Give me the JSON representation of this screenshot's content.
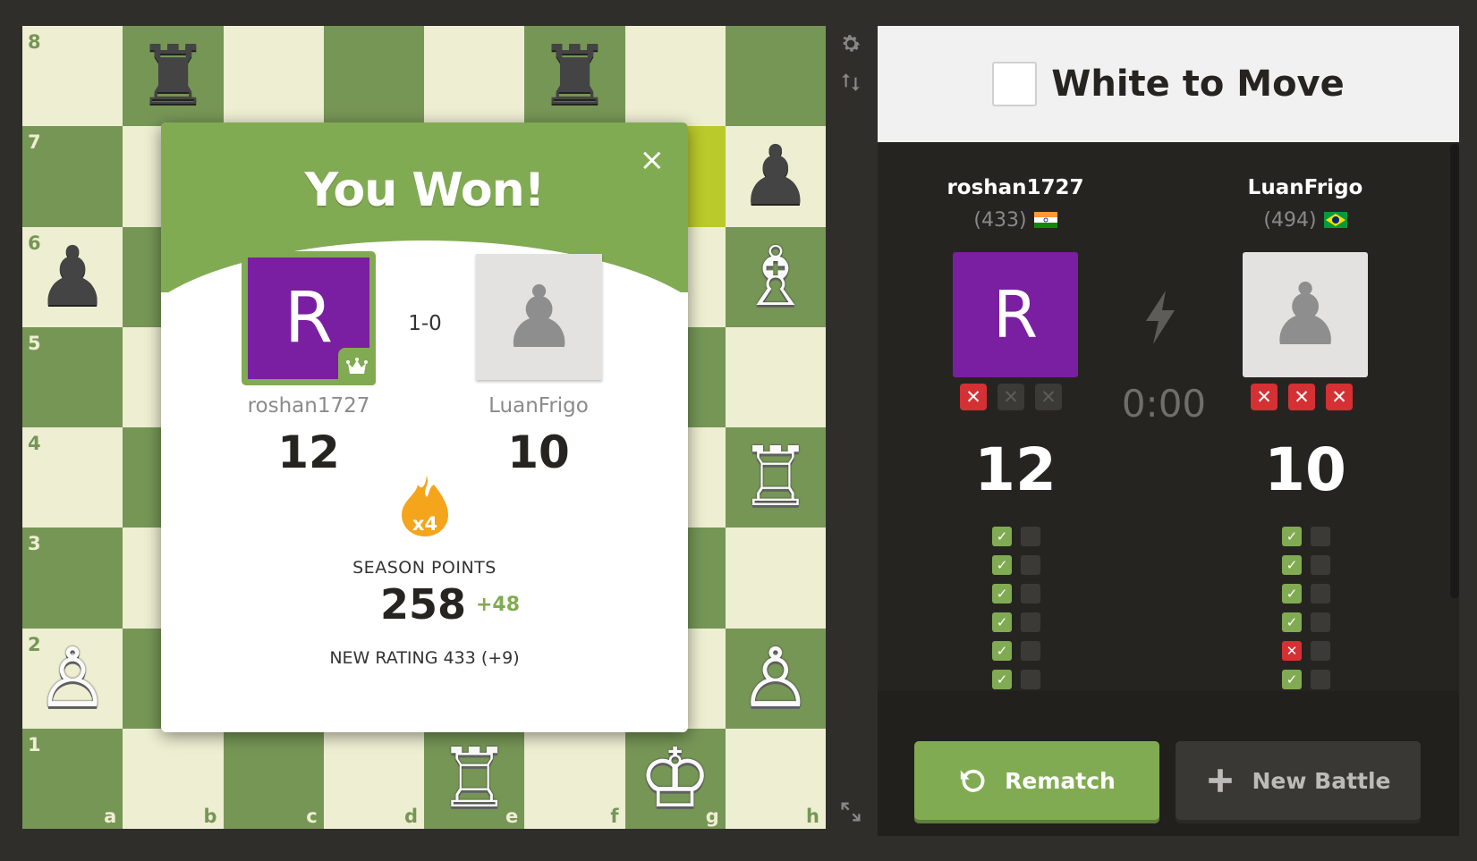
{
  "board": {
    "ranks": [
      "8",
      "7",
      "6",
      "5",
      "4",
      "3",
      "2",
      "1"
    ],
    "files": [
      "a",
      "b",
      "c",
      "d",
      "e",
      "f",
      "g",
      "h"
    ],
    "highlight": [
      "g7"
    ],
    "pieces": [
      {
        "square": "b8",
        "color": "black",
        "type": "rook",
        "glyph": "♜"
      },
      {
        "square": "f8",
        "color": "black",
        "type": "rook",
        "glyph": "♜"
      },
      {
        "square": "h7",
        "color": "black",
        "type": "pawn",
        "glyph": "♟"
      },
      {
        "square": "a6",
        "color": "black",
        "type": "pawn",
        "glyph": "♟"
      },
      {
        "square": "h6",
        "color": "white",
        "type": "bishop",
        "glyph": "♗"
      },
      {
        "square": "h4",
        "color": "white",
        "type": "rook",
        "glyph": "♖"
      },
      {
        "square": "a2",
        "color": "white",
        "type": "pawn",
        "glyph": "♙"
      },
      {
        "square": "h2",
        "color": "white",
        "type": "pawn",
        "glyph": "♙"
      },
      {
        "square": "e1",
        "color": "white",
        "type": "rook",
        "glyph": "♖"
      },
      {
        "square": "g1",
        "color": "white",
        "type": "king",
        "glyph": "♔"
      }
    ]
  },
  "tools": {
    "settings_icon": "gear-icon",
    "flip_icon": "flip-board-icon",
    "expand_icon": "expand-icon"
  },
  "modal": {
    "title": "You Won!",
    "close": "×",
    "score": "1-0",
    "player": {
      "name": "roshan1727",
      "avatar_letter": "R",
      "points": "12",
      "badge_icon": "crown-icon"
    },
    "opponent": {
      "name": "LuanFrigo",
      "avatar_icon": "pawn-avatar",
      "avatar_glyph": "♟",
      "points": "10"
    },
    "multiplier": "x4",
    "season_label": "SEASON POINTS",
    "season_points": "258",
    "season_delta": "+48",
    "new_rating": "NEW RATING 433 (+9)"
  },
  "panel": {
    "status": "White to Move",
    "timer": "0:00",
    "player": {
      "name": "roshan1727",
      "rating": "(433)",
      "flag": "India",
      "avatar_letter": "R",
      "points": "12",
      "strikes": [
        true,
        false,
        false
      ],
      "results": [
        "pass",
        "pass",
        "pass",
        "pass",
        "pass",
        "pass"
      ]
    },
    "opponent": {
      "name": "LuanFrigo",
      "rating": "(494)",
      "flag": "Brazil",
      "avatar_glyph": "♟",
      "points": "10",
      "strikes": [
        true,
        true,
        true
      ],
      "results": [
        "pass",
        "pass",
        "pass",
        "pass",
        "fail",
        "pass"
      ]
    }
  },
  "buttons": {
    "rematch": "Rematch",
    "new_battle": "New Battle"
  },
  "colors": {
    "accent": "#81ab52",
    "danger": "#d53034",
    "avatar_purple": "#7a1fa2",
    "highlight": "#baca2b"
  }
}
